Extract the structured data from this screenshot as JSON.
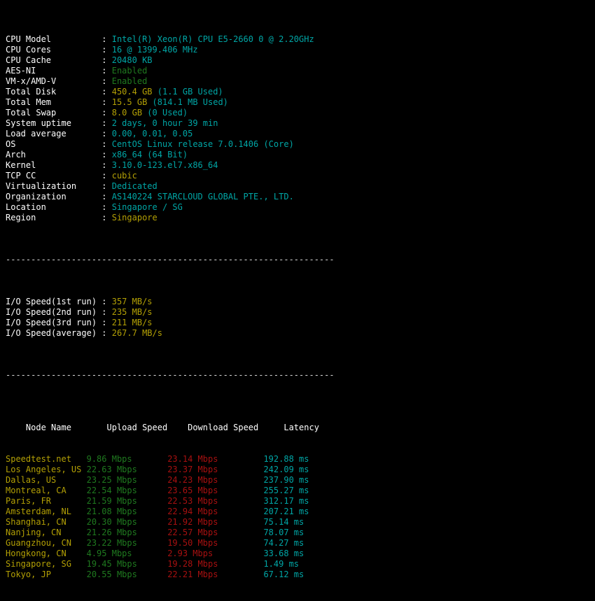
{
  "terminal": {
    "kind": "benchmark-output",
    "colors": {
      "background": "#000000",
      "label": "#ffffff",
      "cyan": "#00a6a6",
      "yellow": "#b3a005",
      "green": "#1f7a1f",
      "red": "#a81010",
      "rule": "#d9d9d9"
    },
    "rule": "-----------------------------------------------------------------"
  },
  "system_info": {
    "rows": [
      {
        "label": "CPU Model",
        "sep": ":",
        "value": "Intel(R) Xeon(R) CPU E5-2660 0 @ 2.20GHz",
        "color": "cyan"
      },
      {
        "label": "CPU Cores",
        "sep": ":",
        "value": "16 @ 1399.406 MHz",
        "color": "cyan"
      },
      {
        "label": "CPU Cache",
        "sep": ":",
        "value": "20480 KB",
        "color": "cyan"
      },
      {
        "label": "AES-NI",
        "sep": ":",
        "value": "Enabled",
        "color": "green"
      },
      {
        "label": "VM-x/AMD-V",
        "sep": ":",
        "value": "Enabled",
        "color": "green"
      },
      {
        "label": "Total Disk",
        "sep": ":",
        "value": "450.4 GB",
        "extra": " (1.1 GB Used)",
        "color": "yellow",
        "extra_color": "cyan"
      },
      {
        "label": "Total Mem",
        "sep": ":",
        "value": "15.5 GB",
        "extra": " (814.1 MB Used)",
        "color": "yellow",
        "extra_color": "cyan"
      },
      {
        "label": "Total Swap",
        "sep": ":",
        "value": "8.0 GB",
        "extra": " (0 Used)",
        "color": "yellow",
        "extra_color": "cyan"
      },
      {
        "label": "System uptime",
        "sep": ":",
        "value": "2 days, 0 hour 39 min",
        "color": "cyan"
      },
      {
        "label": "Load average",
        "sep": ":",
        "value": "0.00, 0.01, 0.05",
        "color": "cyan"
      },
      {
        "label": "OS",
        "sep": ":",
        "value": "CentOS Linux release 7.0.1406 (Core)",
        "color": "cyan"
      },
      {
        "label": "Arch",
        "sep": ":",
        "value": "x86_64 (64 Bit)",
        "color": "cyan"
      },
      {
        "label": "Kernel",
        "sep": ":",
        "value": "3.10.0-123.el7.x86_64",
        "color": "cyan"
      },
      {
        "label": "TCP CC",
        "sep": ":",
        "value": "cubic",
        "color": "yellow"
      },
      {
        "label": "Virtualization",
        "sep": ":",
        "value": "Dedicated",
        "color": "cyan"
      },
      {
        "label": "Organization",
        "sep": ":",
        "value": "AS140224 STARCLOUD GLOBAL PTE., LTD.",
        "color": "cyan"
      },
      {
        "label": "Location",
        "sep": ":",
        "value": "Singapore / SG",
        "color": "cyan"
      },
      {
        "label": "Region",
        "sep": ":",
        "value": "Singapore",
        "color": "yellow"
      }
    ]
  },
  "io_test": {
    "rows": [
      {
        "label": "I/O Speed(1st run)",
        "sep": ":",
        "value": "357 MB/s",
        "color": "yellow"
      },
      {
        "label": "I/O Speed(2nd run)",
        "sep": ":",
        "value": "235 MB/s",
        "color": "yellow"
      },
      {
        "label": "I/O Speed(3rd run)",
        "sep": ":",
        "value": "211 MB/s",
        "color": "yellow"
      },
      {
        "label": "I/O Speed(average)",
        "sep": ":",
        "value": "267.7 MB/s",
        "color": "yellow"
      }
    ]
  },
  "speedtest": {
    "headers": {
      "node": "Node Name",
      "upload": "Upload Speed",
      "download": "Download Speed",
      "latency": "Latency"
    },
    "rows": [
      {
        "node": "Speedtest.net",
        "upload": "9.86 Mbps",
        "download": "23.14 Mbps",
        "latency": "192.88 ms"
      },
      {
        "node": "Los Angeles, US",
        "upload": "22.63 Mbps",
        "download": "23.37 Mbps",
        "latency": "242.09 ms"
      },
      {
        "node": "Dallas, US",
        "upload": "23.25 Mbps",
        "download": "24.23 Mbps",
        "latency": "237.90 ms"
      },
      {
        "node": "Montreal, CA",
        "upload": "22.54 Mbps",
        "download": "23.65 Mbps",
        "latency": "255.27 ms"
      },
      {
        "node": "Paris, FR",
        "upload": "21.59 Mbps",
        "download": "22.53 Mbps",
        "latency": "312.17 ms"
      },
      {
        "node": "Amsterdam, NL",
        "upload": "21.08 Mbps",
        "download": "22.94 Mbps",
        "latency": "207.21 ms"
      },
      {
        "node": "Shanghai, CN",
        "upload": "20.30 Mbps",
        "download": "21.92 Mbps",
        "latency": "75.14 ms"
      },
      {
        "node": "Nanjing, CN",
        "upload": "21.26 Mbps",
        "download": "22.57 Mbps",
        "latency": "78.07 ms"
      },
      {
        "node": "Guangzhou, CN",
        "upload": "23.22 Mbps",
        "download": "19.50 Mbps",
        "latency": "74.27 ms"
      },
      {
        "node": "Hongkong, CN",
        "upload": "4.95 Mbps",
        "download": "2.93 Mbps",
        "latency": "33.68 ms"
      },
      {
        "node": "Singapore, SG",
        "upload": "19.45 Mbps",
        "download": "19.28 Mbps",
        "latency": "1.49 ms"
      },
      {
        "node": "Tokyo, JP",
        "upload": "20.55 Mbps",
        "download": "22.21 Mbps",
        "latency": "67.12 ms"
      }
    ]
  }
}
